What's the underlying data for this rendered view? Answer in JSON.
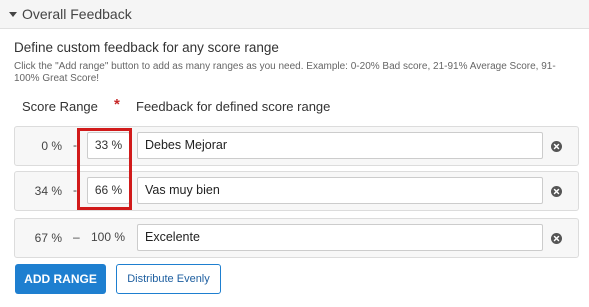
{
  "header": {
    "title": "Overall Feedback"
  },
  "section": {
    "title": "Define custom feedback for any score range",
    "description": "Click the \"Add range\" button to add as many ranges as you need. Example: 0-20% Bad score, 21-91% Average Score, 91-100% Great Score!"
  },
  "columns": {
    "score_range": "Score Range",
    "required_marker": "*",
    "feedback": "Feedback for defined score range"
  },
  "ranges": [
    {
      "start": "0 %",
      "separator": "-",
      "end": "33 %",
      "feedback": "Debes Mejorar"
    },
    {
      "start": "34 %",
      "separator": "-",
      "end": "66 %",
      "feedback": "Vas muy bien"
    },
    {
      "start": "67 %",
      "separator": "–",
      "end": "100 %",
      "feedback": "Excelente"
    }
  ],
  "buttons": {
    "add_range": "ADD RANGE",
    "distribute_evenly": "Distribute Evenly"
  },
  "colors": {
    "accent": "#1e7fd0",
    "highlight": "#d11a1a",
    "required": "#c62828"
  },
  "icons": {
    "header": "caret-down-icon",
    "remove": "remove-circle-x-icon"
  }
}
